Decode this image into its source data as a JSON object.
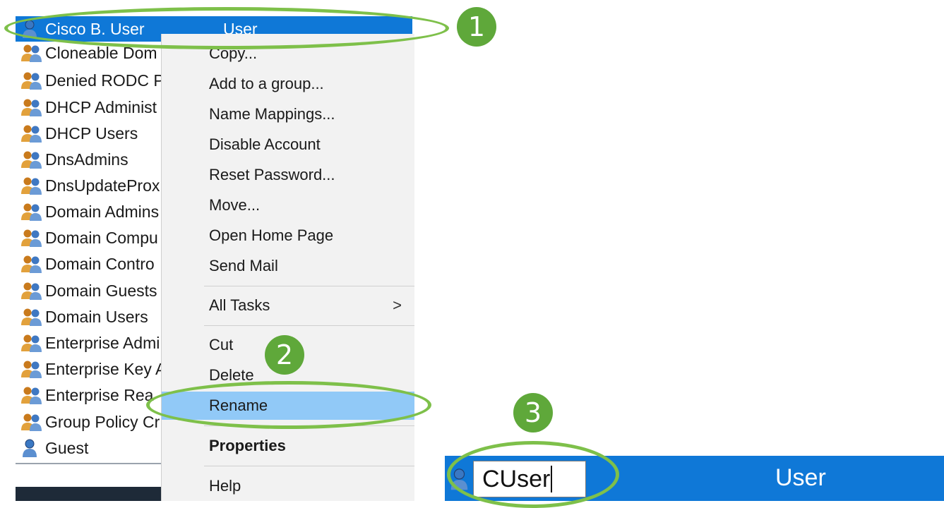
{
  "list": {
    "selected": {
      "name": "Cisco B. User",
      "type": "User",
      "icon": "user-icon"
    },
    "items": [
      {
        "label": "Cloneable Dom",
        "icon": "group-icon"
      },
      {
        "label": "Denied RODC P",
        "icon": "group-icon"
      },
      {
        "label": "DHCP Administ",
        "icon": "group-icon"
      },
      {
        "label": "DHCP Users",
        "icon": "group-icon"
      },
      {
        "label": "DnsAdmins",
        "icon": "group-icon"
      },
      {
        "label": "DnsUpdateProx",
        "icon": "group-icon"
      },
      {
        "label": "Domain Admins",
        "icon": "group-icon"
      },
      {
        "label": "Domain Compu",
        "icon": "group-icon"
      },
      {
        "label": "Domain Contro",
        "icon": "group-icon"
      },
      {
        "label": "Domain Guests",
        "icon": "group-icon"
      },
      {
        "label": "Domain Users",
        "icon": "group-icon"
      },
      {
        "label": "Enterprise Admi",
        "icon": "group-icon"
      },
      {
        "label": "Enterprise Key A",
        "icon": "group-icon"
      },
      {
        "label": "Enterprise Rea",
        "icon": "group-icon"
      },
      {
        "label": "Group Policy Cr",
        "icon": "group-icon"
      },
      {
        "label": "Guest",
        "icon": "user-icon"
      }
    ]
  },
  "context_menu": {
    "items": [
      {
        "label": "Copy..."
      },
      {
        "label": "Add to a group..."
      },
      {
        "label": "Name Mappings..."
      },
      {
        "label": "Disable Account"
      },
      {
        "label": "Reset Password..."
      },
      {
        "label": "Move..."
      },
      {
        "label": "Open Home Page"
      },
      {
        "label": "Send Mail"
      },
      {
        "label": "All Tasks",
        "submenu_arrow": ">"
      },
      {
        "label": "Cut"
      },
      {
        "label": "Delete"
      },
      {
        "label": "Rename",
        "highlighted": true
      },
      {
        "label": "Properties",
        "bold": true
      },
      {
        "label": "Help"
      }
    ]
  },
  "rename_row": {
    "value": "CUser",
    "type": "User",
    "icon": "user-icon"
  },
  "badges": [
    "1",
    "2",
    "3"
  ],
  "colors": {
    "selection": "#0f78d7",
    "menu_highlight": "#91c9f7",
    "annotation": "#7ec04a",
    "badge": "#5fa83a"
  }
}
